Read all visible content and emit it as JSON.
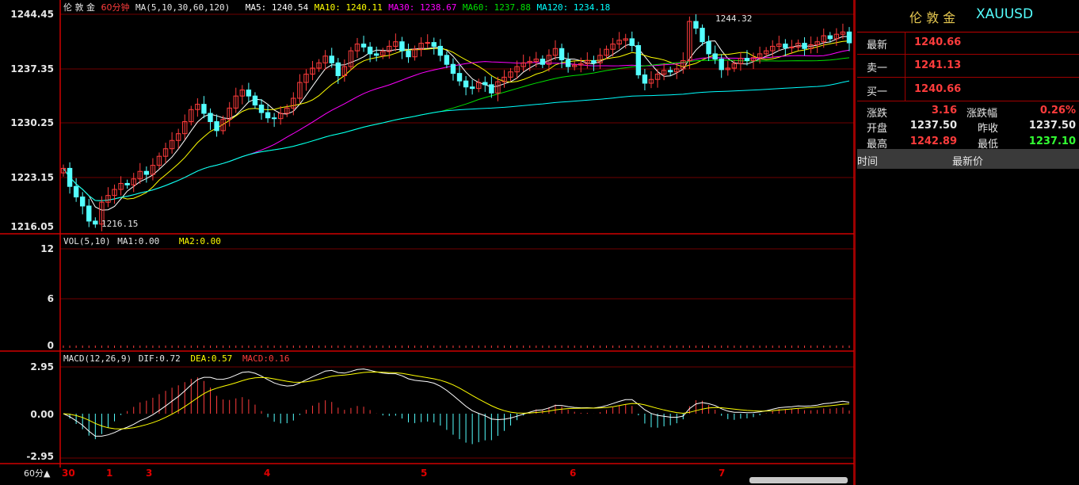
{
  "main_header": {
    "name": "伦 敦 金",
    "period": "60分钟",
    "ma_params": "MA(5,10,30,60,120)",
    "ma5": "MA5: 1240.54",
    "ma10": "MA10: 1240.11",
    "ma30": "MA30: 1238.67",
    "ma60": "MA60: 1237.88",
    "ma120": "MA120: 1234.18"
  },
  "vol_header": {
    "label": "VOL(5,10)",
    "ma1": "MA1:0.00",
    "ma2": "MA2:0.00"
  },
  "macd_header": {
    "label": "MACD(12,26,9)",
    "dif": "DIF:0.72",
    "dea": "DEA:0.57",
    "macd": "MACD:0.16"
  },
  "price_axis": [
    "1244.45",
    "1237.35",
    "1230.25",
    "1223.15",
    "1216.05"
  ],
  "vol_axis": [
    "12",
    "6",
    "0"
  ],
  "macd_axis": [
    "2.95",
    "0.00",
    "-2.95"
  ],
  "x_axis": [
    "30",
    "1",
    "3",
    "4",
    "5",
    "6",
    "7"
  ],
  "period_button": "60分▲",
  "annotations": {
    "high": "1244.32",
    "low": "1216.15"
  },
  "quote": {
    "name": "伦 敦 金",
    "code": "XAUUSD",
    "latest_label": "最新",
    "latest": "1240.66",
    "ask_label": "卖一",
    "ask": "1241.13",
    "bid_label": "买一",
    "bid": "1240.66",
    "change_label": "涨跌",
    "change": "3.16",
    "change_pct_label": "涨跌幅",
    "change_pct": "0.26%",
    "open_label": "开盘",
    "open": "1237.50",
    "prev_close_label": "昨收",
    "prev_close": "1237.50",
    "high_label": "最高",
    "high": "1242.89",
    "low_label": "最低",
    "low": "1237.10",
    "tick_time_header": "时间",
    "tick_price_header": "最新价"
  },
  "colors": {
    "up": "#ff3c3c",
    "down": "#54ffff",
    "border": "#c00000",
    "ma5": "#ffffff",
    "ma10": "#ffff00",
    "ma30": "#ff00ff",
    "ma60": "#00e000",
    "ma120": "#00ffff",
    "price_green": "#33ff33"
  },
  "chart_data": {
    "type": "candlestick",
    "ylim": [
      1216.05,
      1244.45
    ],
    "closes": [
      1224.0,
      1221.6,
      1220.2,
      1219.0,
      1217.0,
      1216.6,
      1219.5,
      1220.4,
      1221.2,
      1222.0,
      1221.8,
      1222.6,
      1223.6,
      1223.2,
      1224.4,
      1225.6,
      1226.6,
      1227.7,
      1228.6,
      1230.2,
      1231.8,
      1232.5,
      1231.3,
      1230.2,
      1229.0,
      1230.5,
      1232.0,
      1233.6,
      1234.4,
      1233.6,
      1232.4,
      1231.4,
      1230.7,
      1230.6,
      1231.3,
      1232.0,
      1233.3,
      1235.4,
      1236.5,
      1237.3,
      1238.0,
      1238.9,
      1238.0,
      1236.3,
      1237.5,
      1239.6,
      1240.5,
      1240.1,
      1239.2,
      1239.0,
      1239.5,
      1240.2,
      1240.8,
      1239.6,
      1238.8,
      1239.8,
      1240.6,
      1240.7,
      1240.2,
      1239.0,
      1237.8,
      1236.6,
      1235.6,
      1234.8,
      1234.6,
      1235.4,
      1235.1,
      1234.0,
      1235.5,
      1236.1,
      1236.8,
      1237.5,
      1238.0,
      1238.2,
      1238.5,
      1237.8,
      1239.0,
      1239.9,
      1238.4,
      1237.5,
      1237.7,
      1237.9,
      1238.3,
      1238.0,
      1239.0,
      1239.8,
      1240.5,
      1241.0,
      1241.2,
      1240.3,
      1236.4,
      1235.3,
      1235.8,
      1236.5,
      1237.0,
      1236.8,
      1237.2,
      1238.3,
      1243.5,
      1242.6,
      1240.8,
      1239.2,
      1238.5,
      1237.1,
      1237.3,
      1237.9,
      1238.6,
      1238.3,
      1238.7,
      1239.2,
      1239.6,
      1240.2,
      1240.5,
      1240.0,
      1240.1,
      1240.6,
      1239.9,
      1240.4,
      1240.8,
      1241.6,
      1241.2,
      1241.8,
      1242.1,
      1240.66
    ]
  }
}
